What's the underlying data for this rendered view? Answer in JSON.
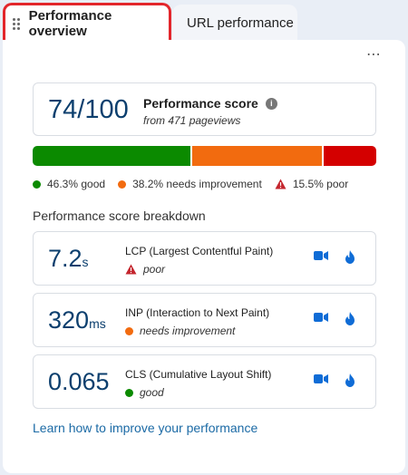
{
  "tabs": [
    {
      "label": "Performance overview",
      "active": true
    },
    {
      "label": "URL performance",
      "active": false
    }
  ],
  "menu": {
    "more_label": "⋯"
  },
  "score": {
    "value": "74/100",
    "title": "Performance score",
    "subtitle": "from 471 pageviews",
    "info_icon": "i"
  },
  "distribution": {
    "good_fraction": 0.463,
    "needs_improvement_fraction": 0.382,
    "poor_fraction": 0.155,
    "good_label": "46.3% good",
    "needs_improvement_label": "38.2% needs improvement",
    "poor_label": "15.5% poor"
  },
  "breakdown_title": "Performance score breakdown",
  "metrics": [
    {
      "value": "7.2",
      "unit": "s",
      "name": "LCP (Largest Contentful Paint)",
      "status": "poor"
    },
    {
      "value": "320",
      "unit": "ms",
      "name": "INP (Interaction to Next Paint)",
      "status": "needs improvement"
    },
    {
      "value": "0.065",
      "unit": "",
      "name": "CLS (Cumulative Layout Shift)",
      "status": "good"
    }
  ],
  "learn_link": "Learn how to improve your performance",
  "colors": {
    "accent": "#0f6cd6",
    "good": "#0b8a00",
    "needs_improvement": "#f26b0f",
    "poor": "#d40000",
    "highlight": "#e3262b"
  }
}
